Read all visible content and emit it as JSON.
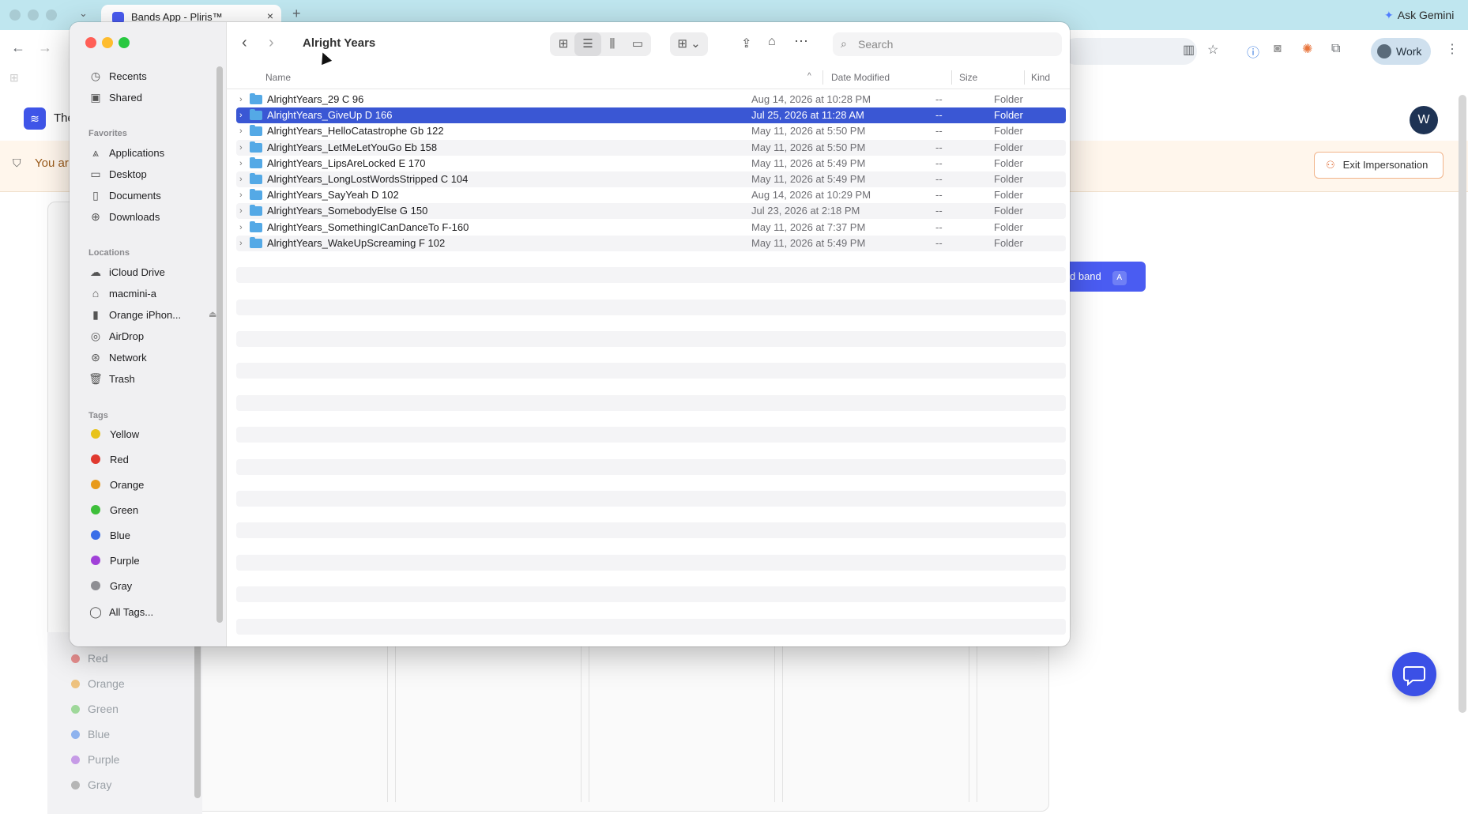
{
  "browser": {
    "tab_title": "Bands App - Pliris™",
    "tab_close": "×",
    "new_tab": "+",
    "ask_gemini": "Ask Gemini",
    "profile": "Work"
  },
  "app": {
    "logo_letter": "≋",
    "title_partial": "The",
    "avatar": "W",
    "banner_partial": "You ar",
    "exit_impersonation": "Exit Impersonation",
    "add_band_partial": "d band",
    "add_band_key": "A",
    "bg_tags": [
      "Red",
      "Orange",
      "Green",
      "Blue",
      "Purple",
      "Gray"
    ],
    "bg_tag_colors": [
      "#e88f8f",
      "#eec27f",
      "#9fd89a",
      "#8fb3ee",
      "#c69be6",
      "#b5b5b5"
    ]
  },
  "finder": {
    "window_title": "Alright Years",
    "search_placeholder": "Search",
    "sidebar": {
      "recents": "Recents",
      "shared": "Shared",
      "favorites_title": "Favorites",
      "favorites": [
        "Applications",
        "Desktop",
        "Documents",
        "Downloads"
      ],
      "locations_title": "Locations",
      "locations": [
        "iCloud Drive",
        "macmini-a",
        "Orange iPhon...",
        "AirDrop",
        "Network",
        "Trash"
      ],
      "tags_title": "Tags",
      "tags": [
        "Yellow",
        "Red",
        "Orange",
        "Green",
        "Blue",
        "Purple",
        "Gray"
      ],
      "tag_colors": [
        "#e8c31a",
        "#e0392f",
        "#e89a1a",
        "#3dbf3a",
        "#3a6ee8",
        "#a040d8",
        "#8e8e93"
      ],
      "all_tags": "All Tags..."
    },
    "columns": {
      "name": "Name",
      "date": "Date Modified",
      "size": "Size",
      "kind": "Kind"
    },
    "rows": [
      {
        "name": "AlrightYears_29 C 96",
        "date": "Aug 14, 2026 at 10:28 PM",
        "size": "--",
        "kind": "Folder"
      },
      {
        "name": "AlrightYears_GiveUp D 166",
        "date": "Jul 25, 2026 at 11:28 AM",
        "size": "--",
        "kind": "Folder"
      },
      {
        "name": "AlrightYears_HelloCatastrophe Gb 122",
        "date": "May 11, 2026 at 5:50 PM",
        "size": "--",
        "kind": "Folder"
      },
      {
        "name": "AlrightYears_LetMeLetYouGo Eb 158",
        "date": "May 11, 2026 at 5:50 PM",
        "size": "--",
        "kind": "Folder"
      },
      {
        "name": "AlrightYears_LipsAreLocked E 170",
        "date": "May 11, 2026 at 5:49 PM",
        "size": "--",
        "kind": "Folder"
      },
      {
        "name": "AlrightYears_LongLostWordsStripped C 104",
        "date": "May 11, 2026 at 5:49 PM",
        "size": "--",
        "kind": "Folder"
      },
      {
        "name": "AlrightYears_SayYeah D 102",
        "date": "Aug 14, 2026 at 10:29 PM",
        "size": "--",
        "kind": "Folder"
      },
      {
        "name": "AlrightYears_SomebodyElse G 150",
        "date": "Jul 23, 2026 at 2:18 PM",
        "size": "--",
        "kind": "Folder"
      },
      {
        "name": "AlrightYears_SomethingICanDanceTo F-160",
        "date": "May 11, 2026 at 7:37 PM",
        "size": "--",
        "kind": "Folder"
      },
      {
        "name": "AlrightYears_WakeUpScreaming F 102",
        "date": "May 11, 2026 at 5:49 PM",
        "size": "--",
        "kind": "Folder"
      }
    ],
    "selected_row": 1
  }
}
